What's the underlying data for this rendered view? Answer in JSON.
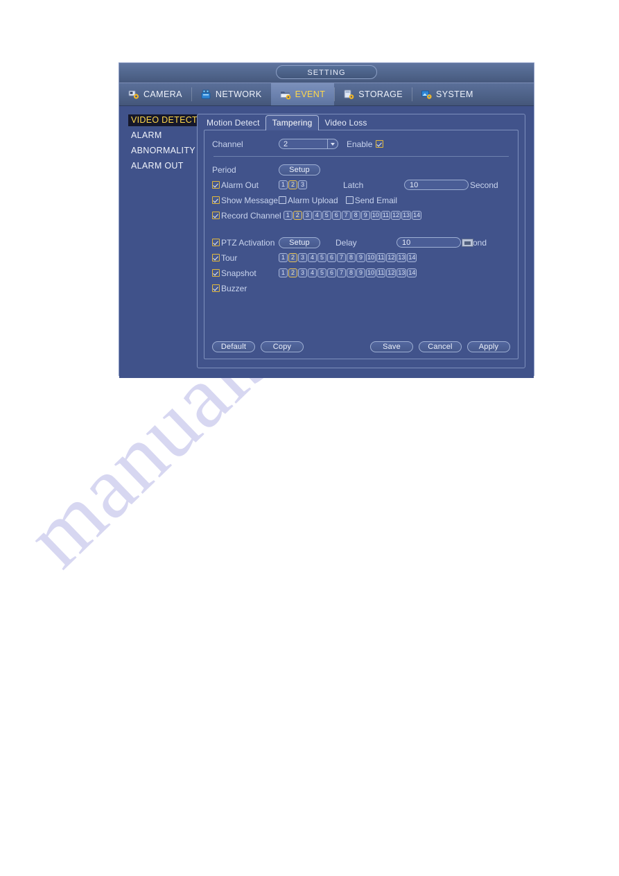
{
  "window": {
    "title": "SETTING"
  },
  "topnav": {
    "items": [
      {
        "label": "CAMERA",
        "icon": "camera-gear-icon",
        "active": false
      },
      {
        "label": "NETWORK",
        "icon": "network-icon",
        "active": false
      },
      {
        "label": "EVENT",
        "icon": "event-folder-icon",
        "active": true
      },
      {
        "label": "STORAGE",
        "icon": "storage-disk-icon",
        "active": false
      },
      {
        "label": "SYSTEM",
        "icon": "system-gear-icon",
        "active": false
      }
    ]
  },
  "sidebar": {
    "items": [
      {
        "label": "VIDEO DETECT",
        "active": true
      },
      {
        "label": "ALARM",
        "active": false
      },
      {
        "label": "ABNORMALITY",
        "active": false
      },
      {
        "label": "ALARM OUT",
        "active": false
      }
    ]
  },
  "subtabs": {
    "items": [
      {
        "label": "Motion Detect",
        "active": false
      },
      {
        "label": "Tampering",
        "active": true
      },
      {
        "label": "Video Loss",
        "active": false
      }
    ]
  },
  "form": {
    "channel_label": "Channel",
    "channel_value": "2",
    "enable_label": "Enable",
    "enable_checked": true,
    "period_label": "Period",
    "period_button": "Setup",
    "alarm_out_label": "Alarm Out",
    "alarm_out_checked": true,
    "alarm_out_chips": [
      "1",
      "2",
      "3"
    ],
    "alarm_out_selected": [
      "2"
    ],
    "latch_label": "Latch",
    "latch_value": "10",
    "latch_unit": "Second",
    "show_message_label": "Show Message",
    "show_message_checked": true,
    "alarm_upload_label": "Alarm Upload",
    "alarm_upload_checked": false,
    "send_email_label": "Send Email",
    "send_email_checked": false,
    "record_channel_label": "Record Channel",
    "record_channel_checked": true,
    "record_channel_chips": [
      "1",
      "2",
      "3",
      "4",
      "5",
      "6",
      "7",
      "8",
      "9",
      "10",
      "11",
      "12",
      "13",
      "14"
    ],
    "record_channel_selected": [
      "2"
    ],
    "ptz_activation_label": "PTZ Activation",
    "ptz_activation_checked": true,
    "ptz_button": "Setup",
    "delay_label": "Delay",
    "delay_value": "10",
    "delay_unit": "ond",
    "tour_label": "Tour",
    "tour_checked": true,
    "tour_chips": [
      "1",
      "2",
      "3",
      "4",
      "5",
      "6",
      "7",
      "8",
      "9",
      "10",
      "11",
      "12",
      "13",
      "14"
    ],
    "tour_selected": [
      "2"
    ],
    "snapshot_label": "Snapshot",
    "snapshot_checked": true,
    "snapshot_chips": [
      "1",
      "2",
      "3",
      "4",
      "5",
      "6",
      "7",
      "8",
      "9",
      "10",
      "11",
      "12",
      "13",
      "14"
    ],
    "snapshot_selected": [
      "2"
    ],
    "buzzer_label": "Buzzer",
    "buzzer_checked": true
  },
  "footer": {
    "default_label": "Default",
    "copy_label": "Copy",
    "save_label": "Save",
    "cancel_label": "Cancel",
    "apply_label": "Apply"
  },
  "watermark": {
    "text": "manualshive.com"
  },
  "colors": {
    "accent_yellow": "#ffd84a",
    "window_bg": "#40528a",
    "panel_bg": "#41538b",
    "border": "#7e90bd",
    "text": "#c9d4ee"
  }
}
